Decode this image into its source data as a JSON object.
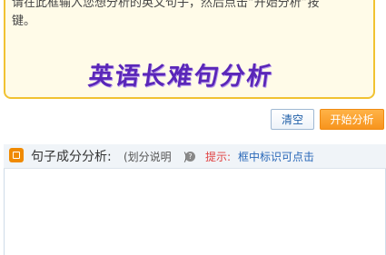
{
  "input": {
    "hint": "请在此框输入您想分析的英文句子，然后点击“开始分析”按\n键。",
    "banner": "英语长难句分析"
  },
  "actions": {
    "clear_label": "清空",
    "start_label": "开始分析"
  },
  "analysis": {
    "title": "句子成分分析:",
    "note": "(划分说明",
    "note_close": ")",
    "help_icon": "question-icon",
    "tip_label": "提示:",
    "tip_text": "框中标识可点击"
  },
  "colors": {
    "input_border": "#f1c232",
    "banner_text": "#5a27b8",
    "start_button": "#f7941d",
    "clear_text": "#1f5fa8",
    "tip_label": "#e04040",
    "tip_text": "#2a68b8"
  }
}
